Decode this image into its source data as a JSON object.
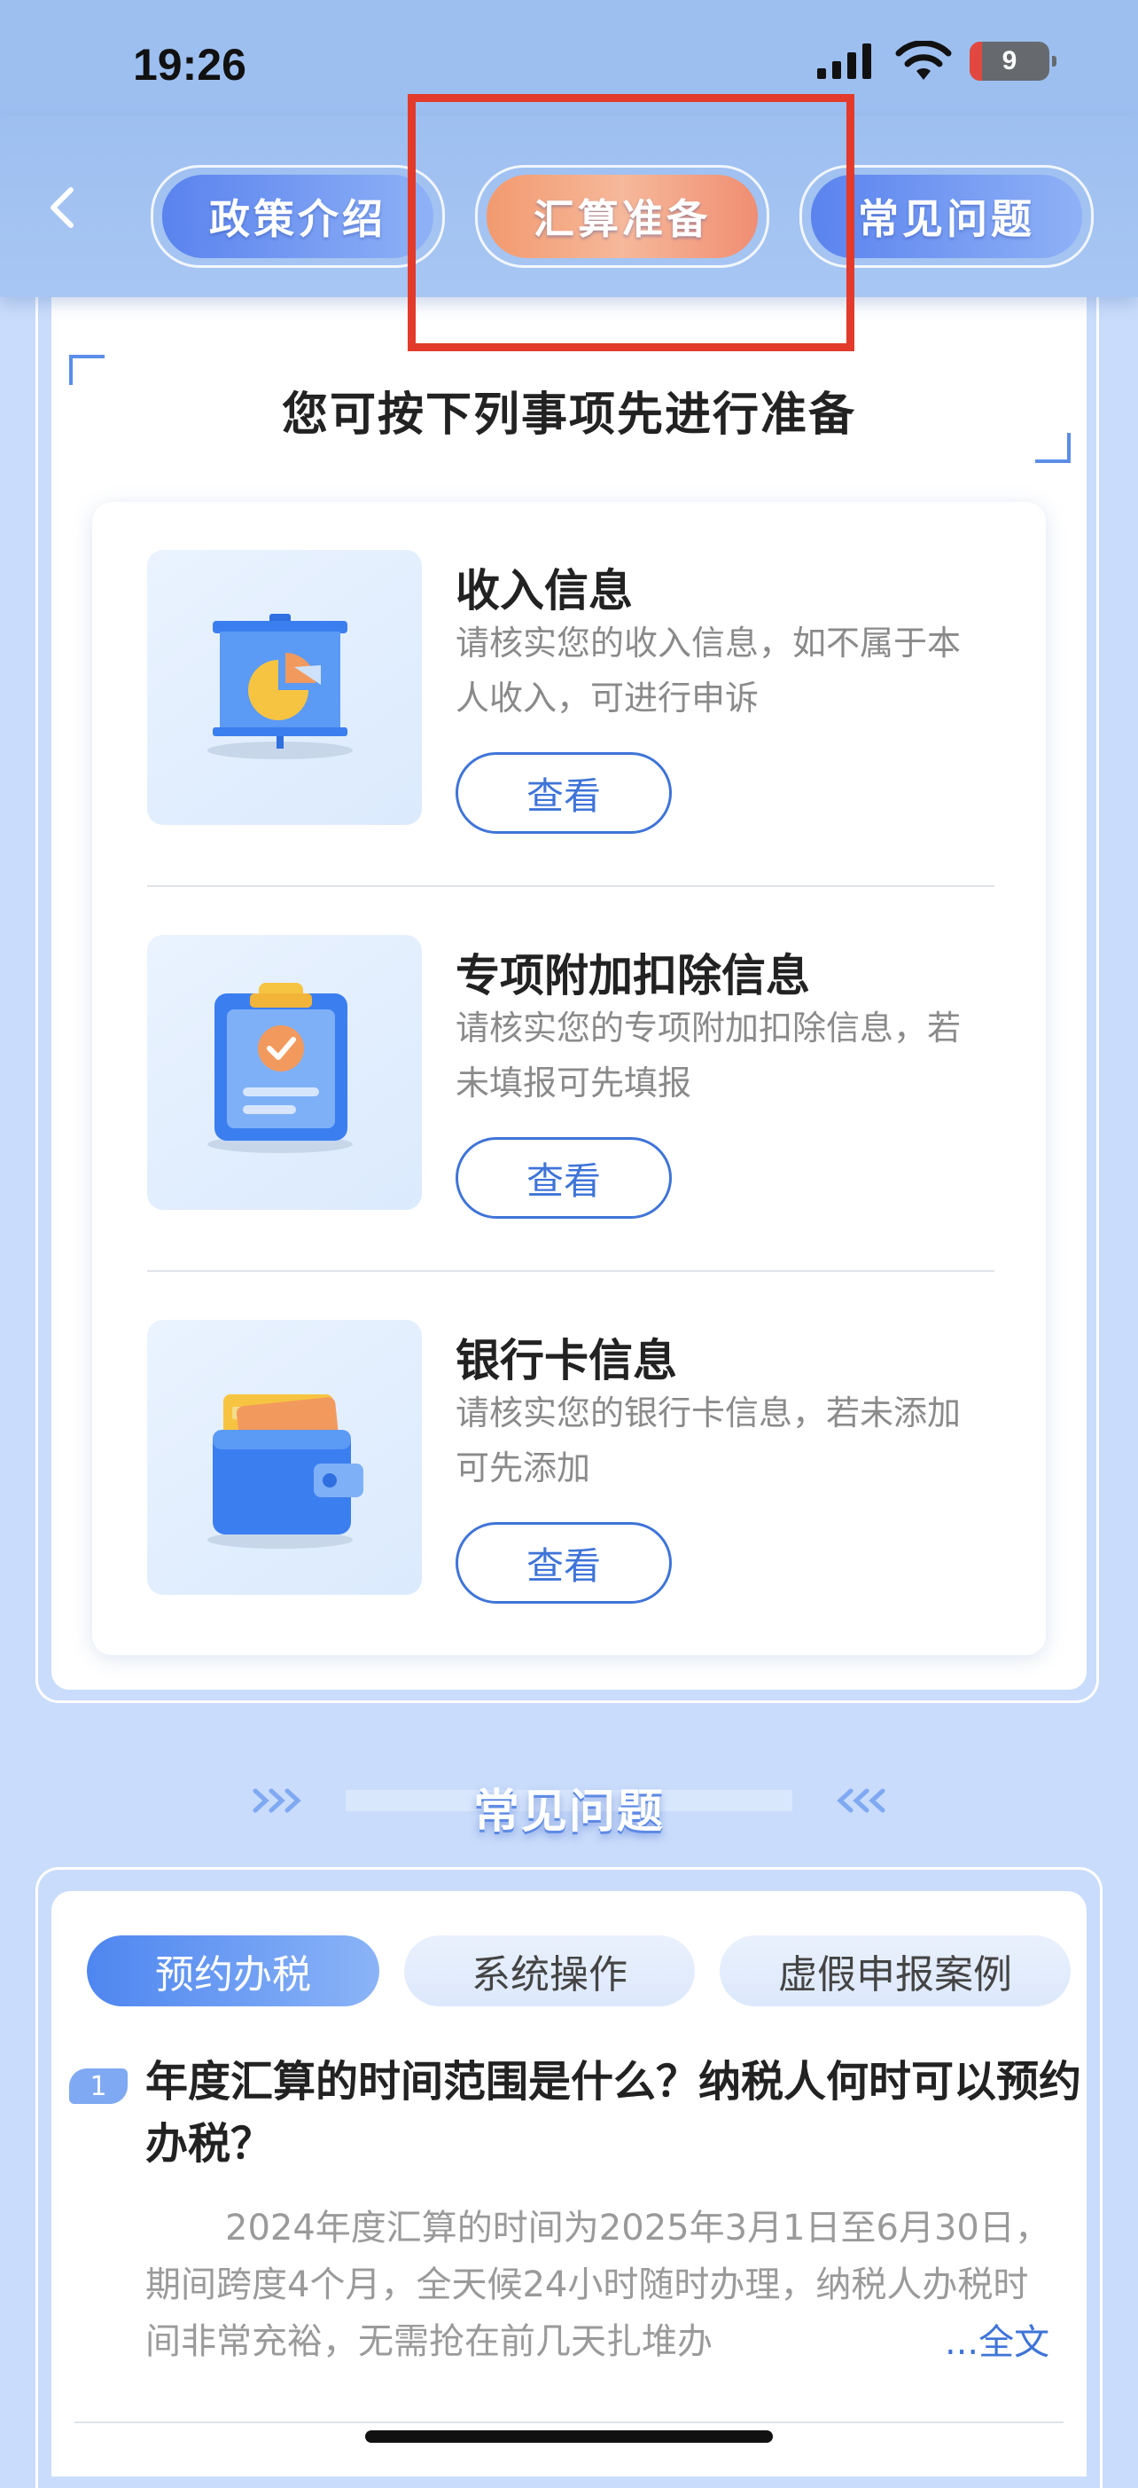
{
  "status_bar": {
    "time": "19:26",
    "battery_level": "9"
  },
  "nav": {
    "tabs": [
      {
        "label": "政策介绍"
      },
      {
        "label": "汇算准备"
      },
      {
        "label": "常见问题"
      }
    ],
    "active_tab": "汇算准备"
  },
  "prep": {
    "title": "您可按下列事项先进行准备",
    "items": [
      {
        "title": "收入信息",
        "desc": "请核实您的收入信息，如不属于本人收入，可进行申诉",
        "button": "查看",
        "icon": "presentation-chart-icon"
      },
      {
        "title": "专项附加扣除信息",
        "desc": "请核实您的专项附加扣除信息，若未填报可先填报",
        "button": "查看",
        "icon": "clipboard-check-icon"
      },
      {
        "title": "银行卡信息",
        "desc": "请核实您的银行卡信息，若未添加可先添加",
        "button": "查看",
        "icon": "wallet-icon"
      }
    ]
  },
  "faq": {
    "title": "常见问题",
    "tabs": [
      {
        "label": "预约办税"
      },
      {
        "label": "系统操作"
      },
      {
        "label": "虚假申报案例"
      }
    ],
    "active_tab": "预约办税",
    "questions": [
      {
        "number": "1",
        "question": "年度汇算的时间范围是什么？纳税人何时可以预约办税？",
        "answer": "2024年度汇算的时间为2025年3月1日至6月30日，期间跨度4个月，全天候24小时随时办理，纳税人办税时间非常充裕，无需抢在前几天扎堆办",
        "read_more": "...全文"
      }
    ]
  },
  "colors": {
    "accent": "#3f74d8",
    "active_pill": "#f29a6f",
    "highlight": "#e23b2b"
  }
}
